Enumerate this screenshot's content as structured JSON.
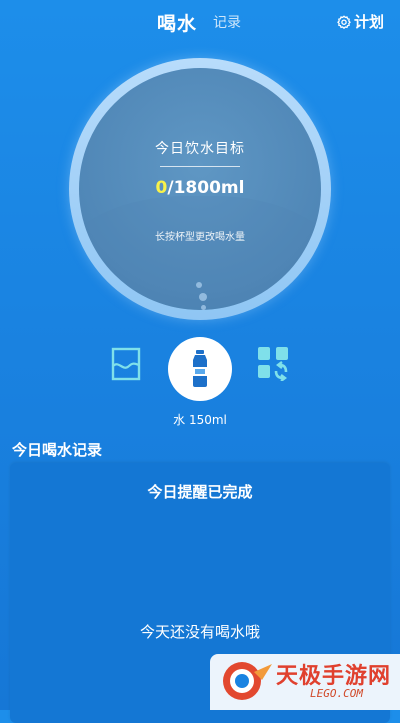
{
  "header": {
    "tabs": [
      {
        "label": "喝水",
        "active": true
      },
      {
        "label": "记录",
        "active": false
      }
    ],
    "plan_label": "计划",
    "plan_icon": "gear-icon"
  },
  "goal": {
    "title": "今日饮水目标",
    "current": "0",
    "target": "/1800ml",
    "progress": 0,
    "hint": "长按杯型更改喝水量"
  },
  "controls": {
    "left_icon": "water-level-icon",
    "center_icon": "water-bottle-icon",
    "right_icon": "swap-icon",
    "cup_label": "水 150ml"
  },
  "records": {
    "title": "今日喝水记录",
    "reminder_status": "今日提醒已完成",
    "empty_text": "今天还没有喝水哦"
  },
  "watermark": {
    "text": "天极手游网",
    "sub": "LEGO.COM"
  },
  "colors": {
    "background": "#1a83e1",
    "ring": "#a9d3f8",
    "accent_value": "#f8f24a",
    "watermark_red": "#e0402e"
  }
}
